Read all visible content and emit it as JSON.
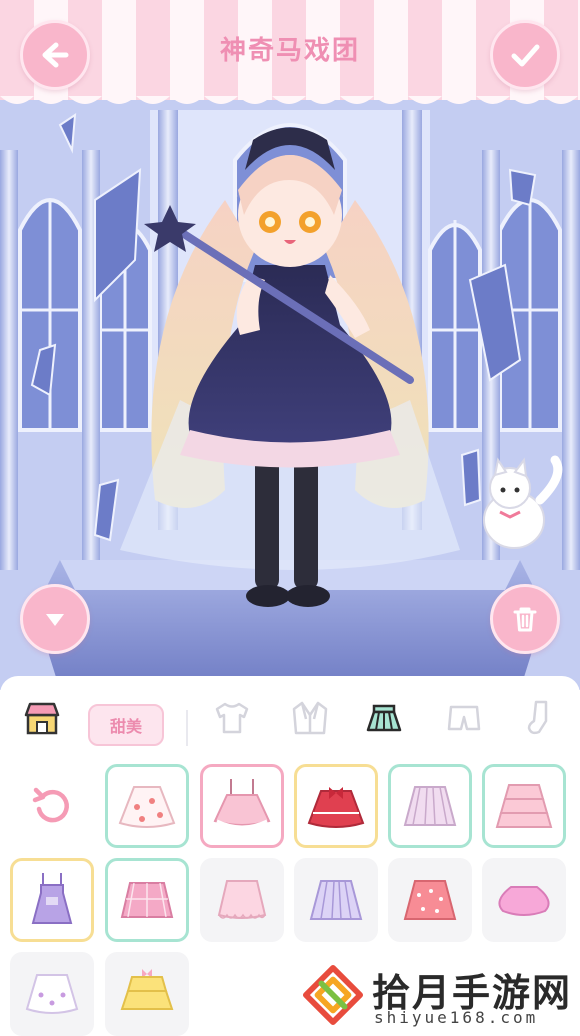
{
  "header": {
    "title": "神奇马戏团",
    "back_icon": "arrow-left-icon",
    "confirm_icon": "check-icon"
  },
  "scene": {
    "collapse_icon": "caret-down-icon",
    "trash_icon": "trash-icon"
  },
  "category_bar": {
    "shop_icon": "shop-icon",
    "style_tag": "甜美",
    "categories": [
      {
        "name": "top",
        "icon": "tshirt-icon",
        "active": false
      },
      {
        "name": "jacket",
        "icon": "jacket-icon",
        "active": false
      },
      {
        "name": "skirt",
        "icon": "skirt-icon",
        "active": true
      },
      {
        "name": "shorts",
        "icon": "shorts-icon",
        "active": false
      },
      {
        "name": "socks",
        "icon": "sock-icon",
        "active": false
      }
    ]
  },
  "colors": {
    "accent_pink": "#f9b6cb",
    "title_pink": "#ef8fb3",
    "border_mint": "#a7e4d2",
    "border_yellow": "#f7de94"
  },
  "items": [
    {
      "id": "reset",
      "icon": "reset-icon"
    },
    {
      "id": "skirt-strawberry",
      "state": "owned"
    },
    {
      "id": "skirt-pink-suspender",
      "state": "selected"
    },
    {
      "id": "skirt-red-bow",
      "state": "featured"
    },
    {
      "id": "skirt-lilac-pleated",
      "state": "owned"
    },
    {
      "id": "skirt-pink-tiered",
      "state": "owned"
    },
    {
      "id": "overall-purple",
      "state": "featured"
    },
    {
      "id": "skirt-pink-plaid",
      "state": "owned"
    },
    {
      "id": "skirt-pink-lace",
      "state": "normal"
    },
    {
      "id": "skirt-lavender-pleated",
      "state": "normal"
    },
    {
      "id": "skirt-coral-dots",
      "state": "normal"
    },
    {
      "id": "skirt-pink-bubble",
      "state": "normal"
    },
    {
      "id": "skirt-white-ribbon",
      "state": "normal"
    },
    {
      "id": "skirt-yellow-tiered",
      "state": "normal"
    }
  ],
  "watermark": {
    "text": "拾月手游网",
    "url": "shiyue168.com"
  }
}
